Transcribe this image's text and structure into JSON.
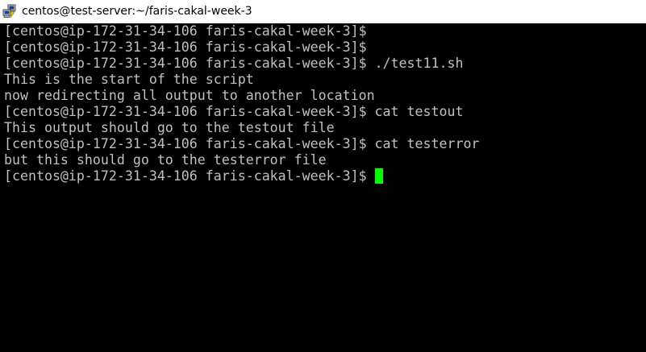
{
  "window": {
    "title": "centos@test-server:~/faris-cakal-week-3",
    "app_icon": "putty-icon"
  },
  "terminal": {
    "lines": [
      "[centos@ip-172-31-34-106 faris-cakal-week-3]$",
      "[centos@ip-172-31-34-106 faris-cakal-week-3]$",
      "[centos@ip-172-31-34-106 faris-cakal-week-3]$ ./test11.sh",
      "This is the start of the script",
      "now redirecting all output to another location",
      "[centos@ip-172-31-34-106 faris-cakal-week-3]$ cat testout",
      "This output should go to the testout file",
      "[centos@ip-172-31-34-106 faris-cakal-week-3]$ cat testerror",
      "but this should go to the testerror file"
    ],
    "prompt": "[centos@ip-172-31-34-106 faris-cakal-week-3]$ ",
    "colors": {
      "background": "#000000",
      "text": "#c0c0c0",
      "cursor": "#00ff00"
    }
  }
}
